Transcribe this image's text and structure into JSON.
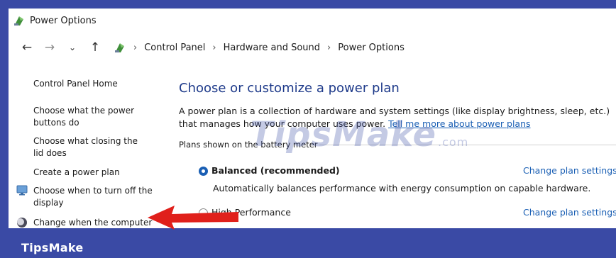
{
  "window": {
    "title": "Power Options"
  },
  "breadcrumb": [
    "Control Panel",
    "Hardware and Sound",
    "Power Options"
  ],
  "sidebar": {
    "home": "Control Panel Home",
    "items": [
      "Choose what the power buttons do",
      "Choose what closing the lid does",
      "Create a power plan",
      "Choose when to turn off the display",
      "Change when the computer"
    ]
  },
  "main": {
    "heading": "Choose or customize a power plan",
    "description": "A power plan is a collection of hardware and system settings (like display brightness, sleep, etc.) that manages how your computer uses power.",
    "tell_me_link": "Tell me more about power plans",
    "group_label": "Plans shown on the battery meter",
    "plans": [
      {
        "name": "Balanced (recommended)",
        "selected": true,
        "description": "Automatically balances performance with energy consumption on capable hardware.",
        "link": "Change plan settings"
      },
      {
        "name": "High Performance",
        "selected": false,
        "link": "Change plan settings"
      }
    ]
  },
  "watermark": {
    "text": "TipsMake",
    "suffix": ".com"
  },
  "brand": "TipsMake",
  "colors": {
    "frame": "#3a4aa5",
    "heading": "#1e3a8a",
    "link": "#1a5fb4",
    "arrow": "#e0201b"
  }
}
